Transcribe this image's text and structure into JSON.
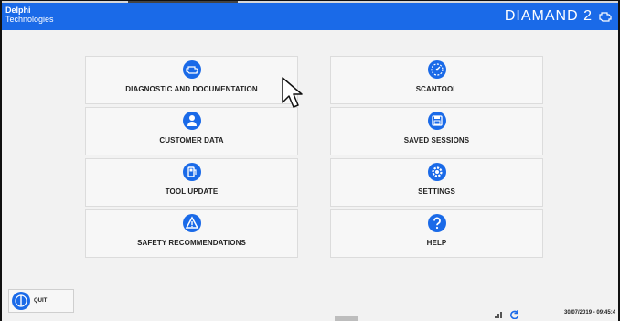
{
  "header": {
    "logo_line1": "Delphi",
    "logo_line2": "Technologies",
    "brand": "DIAMAND 2"
  },
  "menu": {
    "diagnostic": "DIAGNOSTIC AND DOCUMENTATION",
    "scantool": "SCANTOOL",
    "customer": "CUSTOMER DATA",
    "saved": "SAVED SESSIONS",
    "update": "TOOL UPDATE",
    "settings": "SETTINGS",
    "safety": "SAFETY RECOMMENDATIONS",
    "help": "HELP"
  },
  "footer": {
    "quit": "QUIT",
    "datetime": "30/07/2019 - 09:45:4"
  },
  "colors": {
    "accent": "#1a6ae8",
    "header_bg": "#1a6ae8",
    "tile_bg": "#f7f7f7"
  },
  "icons": {
    "diagnostic": "engine-icon",
    "scantool": "gauge-icon",
    "customer": "person-icon",
    "saved": "disk-icon",
    "update": "fuel-icon",
    "settings": "gear-icon",
    "safety": "warning-icon",
    "help": "question-icon",
    "quit": "power-icon"
  }
}
